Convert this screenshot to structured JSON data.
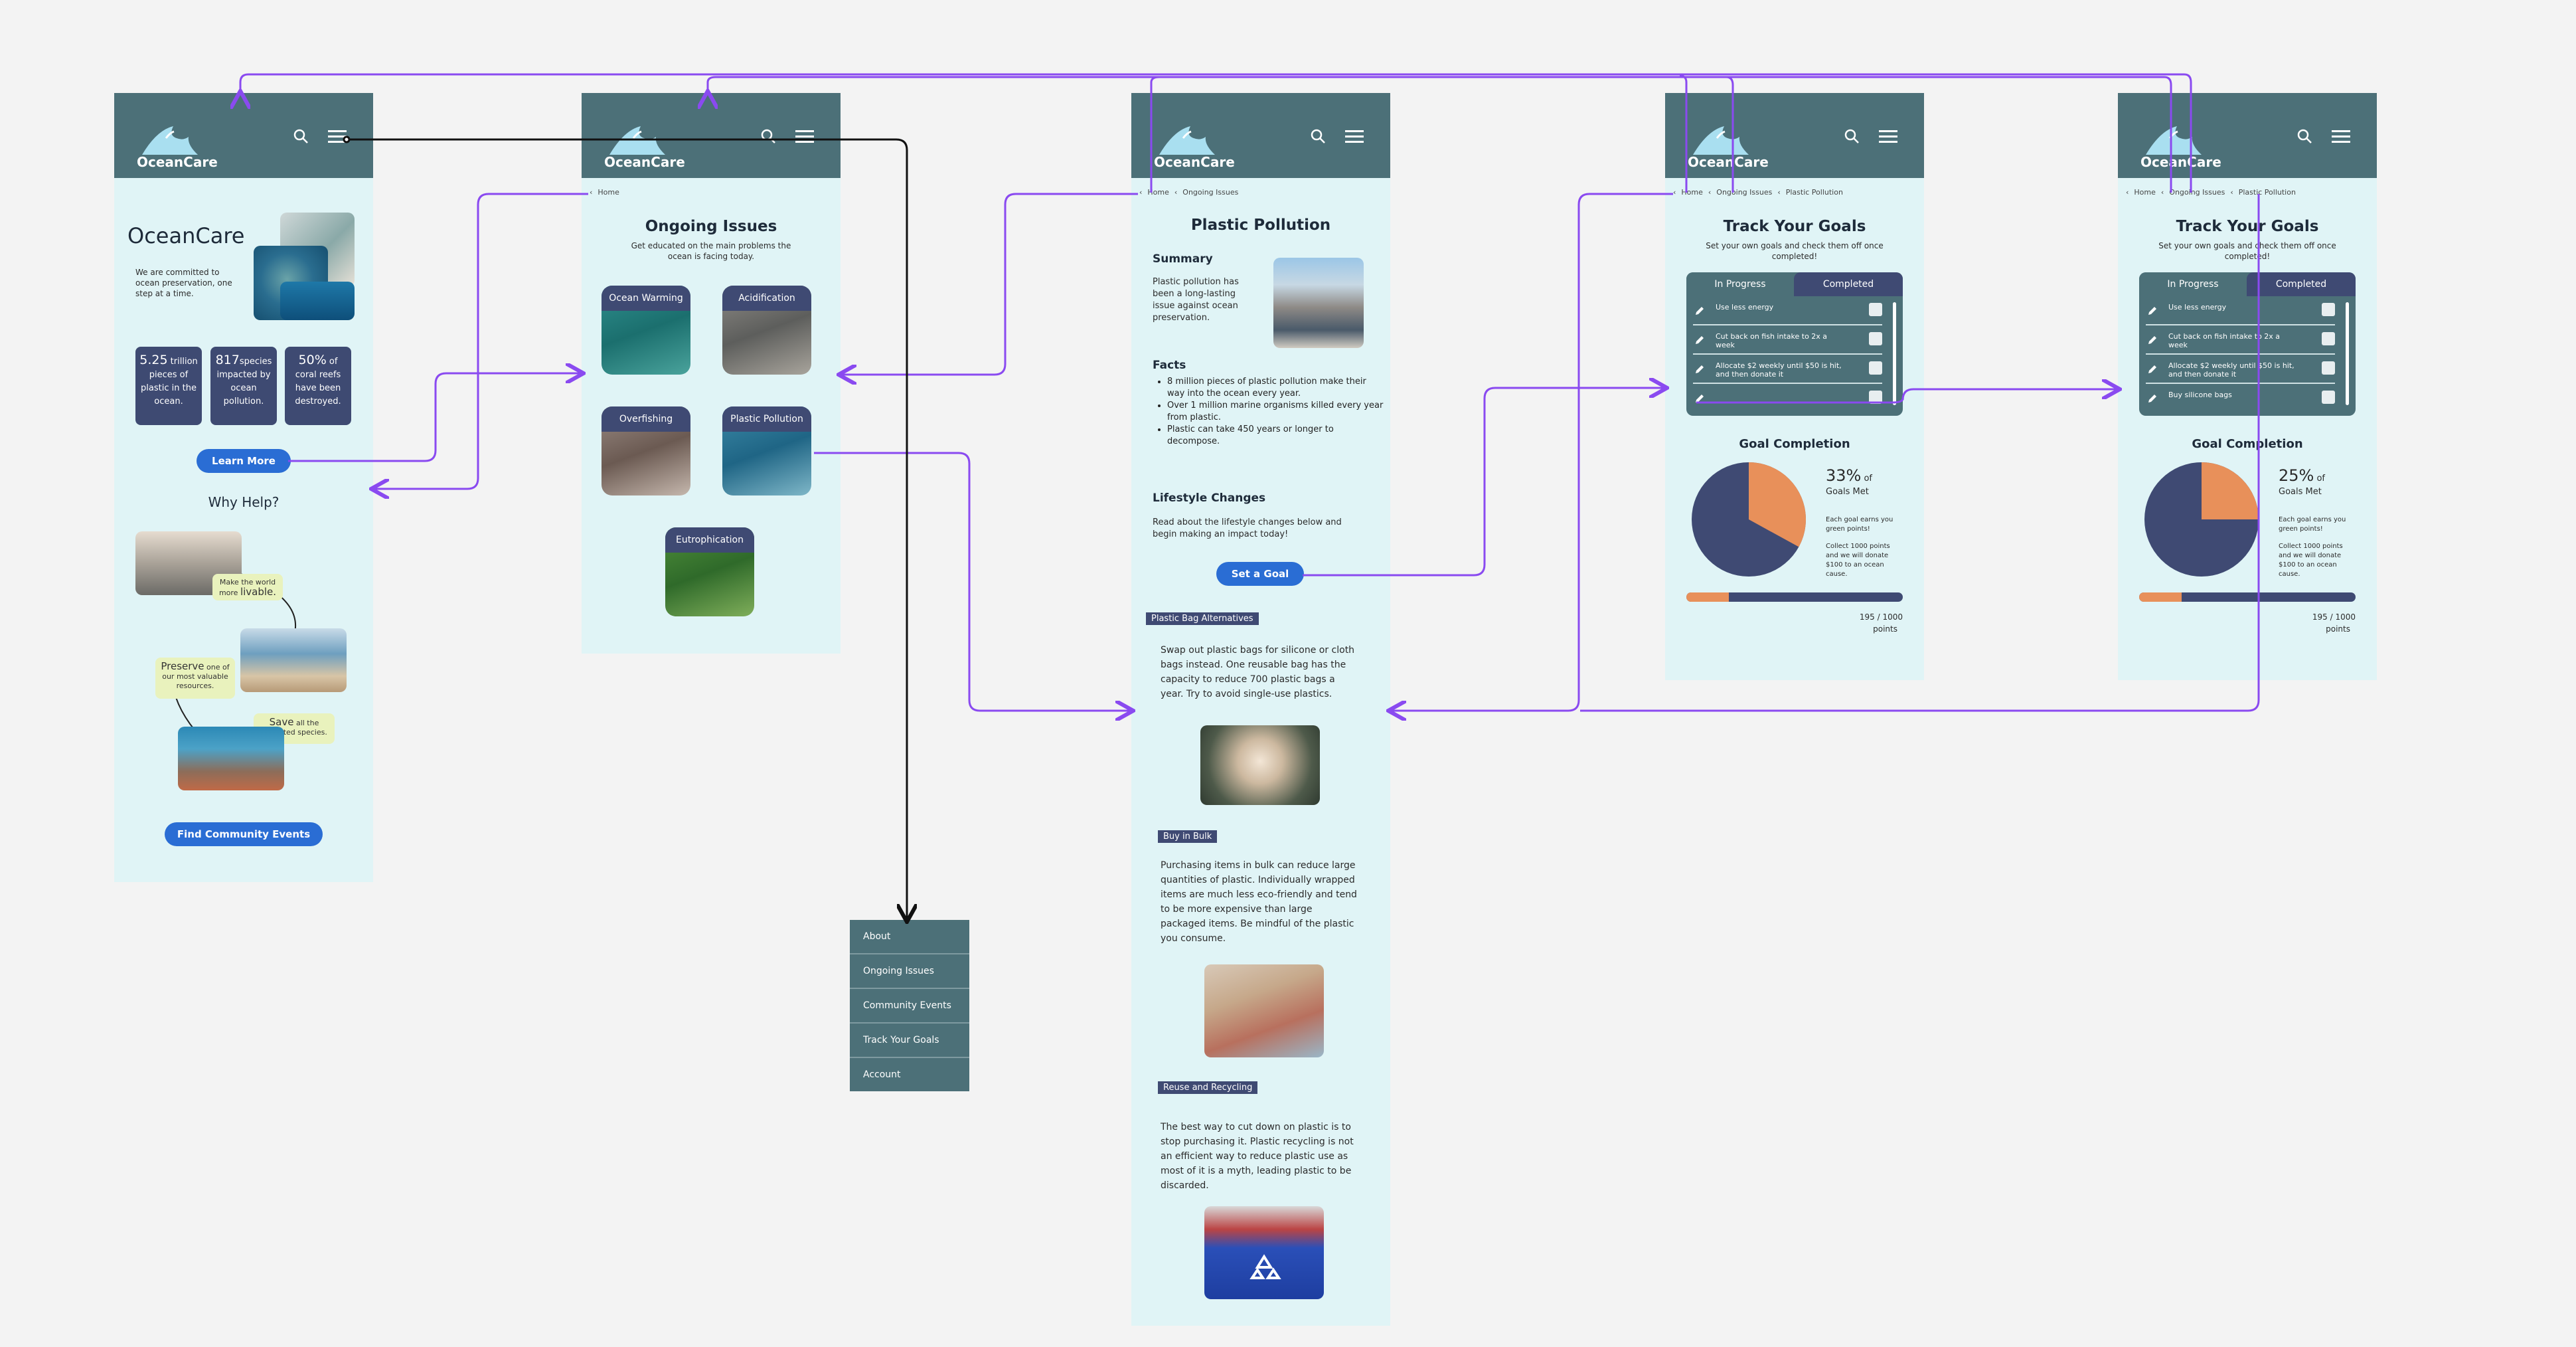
{
  "brand": "OceanCare",
  "colors": {
    "header": "#4c7078",
    "frame": "#e0f4f6",
    "card": "#3f4a73",
    "button": "#2a6dd4",
    "accent": "#e8905a",
    "connector": "#8a4af0"
  },
  "home": {
    "title": "OceanCare",
    "tagline": "We are committed to ocean preservation, one step at a time.",
    "stats": [
      {
        "big": "5.25",
        "rest": " trillion pieces of plastic in the ocean."
      },
      {
        "big": "817",
        "rest": "species impacted by ocean pollution."
      },
      {
        "big": "50%",
        "rest": " of coral reefs have been destroyed."
      }
    ],
    "learn_more": "Learn More",
    "why_help": "Why Help?",
    "notes": [
      {
        "pre": "Make the world more ",
        "big": "livable.",
        "post": ""
      },
      {
        "pre": "",
        "big": "Preserve",
        "post": " one of our most valuable resources."
      },
      {
        "pre": "",
        "big": "Save",
        "post": " all the impacted species."
      }
    ],
    "find_events": "Find Community Events"
  },
  "issues": {
    "crumb": "Home",
    "title": "Ongoing Issues",
    "subtitle": "Get educated on the main problems the ocean is facing today.",
    "tiles": [
      "Ocean Warming",
      "Acidification",
      "Overfishing",
      "Plastic Pollution",
      "Eutrophication"
    ]
  },
  "menu": {
    "items": [
      "About",
      "Ongoing Issues",
      "Community Events",
      "Track Your Goals",
      "Account"
    ]
  },
  "plastic": {
    "crumbs": [
      "Home",
      "Ongoing Issues"
    ],
    "title": "Plastic Pollution",
    "summary_h": "Summary",
    "summary": "Plastic pollution has been a long-lasting issue against ocean preservation.",
    "facts_h": "Facts",
    "facts": [
      "8 million pieces of plastic pollution make their way into the ocean every year.",
      "Over 1 million marine organisms killed every year from plastic.",
      "Plastic can take 450 years or longer to decompose."
    ],
    "lifestyle_h": "Lifestyle Changes",
    "lifestyle": "Read about the lifestyle changes below and begin making an impact today!",
    "set_goal": "Set a Goal",
    "sections": [
      {
        "tag": "Plastic Bag Alternatives",
        "text": "Swap out plastic bags for silicone or cloth bags instead. One reusable bag has the capacity to reduce 700 plastic bags a year. Try to avoid single-use plastics."
      },
      {
        "tag": "Buy in Bulk",
        "text": "Purchasing items in bulk can reduce large quantities of plastic. Individually wrapped items are much less eco-friendly and tend to be more expensive than large packaged items. Be mindful of the plastic you consume."
      },
      {
        "tag": "Reuse and Recycling",
        "text": "The best way to cut down on plastic is to stop purchasing it. Plastic recycling is not an efficient way to reduce plastic use as most of it is a myth, leading plastic to be discarded."
      }
    ]
  },
  "goals1": {
    "crumbs": [
      "Home",
      "Ongoing Issues",
      "Plastic Pollution"
    ],
    "title": "Track Your Goals",
    "subtitle": "Set your own goals and check them off once completed!",
    "tab_progress": "In Progress",
    "tab_completed": "Completed",
    "items": [
      "Use less energy",
      "Cut back on fish intake to 2x a week",
      "Allocate $2 weekly until $50 is hit, and then donate it",
      ""
    ],
    "completion_h": "Goal Completion",
    "pct": "33%",
    "of": " of",
    "goals_met": "Goals Met",
    "note1": "Each goal earns you green points!",
    "note2": "Collect 1000 points and we will donate $100 to an ocean cause.",
    "points": "195 / 1000",
    "points_label": "points",
    "pie_fraction": 0.33,
    "progress": 0.195
  },
  "goals2": {
    "crumbs": [
      "Home",
      "Ongoing Issues",
      "Plastic Pollution"
    ],
    "title": "Track Your Goals",
    "subtitle": "Set your own goals and check them off once completed!",
    "tab_progress": "In Progress",
    "tab_completed": "Completed",
    "items": [
      "Use less energy",
      "Cut back on fish intake to 2x a week",
      "Allocate $2 weekly until $50 is hit, and then donate it",
      "Buy silicone bags"
    ],
    "completion_h": "Goal Completion",
    "pct": "25%",
    "of": " of",
    "goals_met": "Goals Met",
    "note1": "Each goal earns you green points!",
    "note2": "Collect 1000 points and we will donate $100 to an ocean cause.",
    "points": "195 / 1000",
    "points_label": "points",
    "pie_fraction": 0.25,
    "progress": 0.195
  }
}
